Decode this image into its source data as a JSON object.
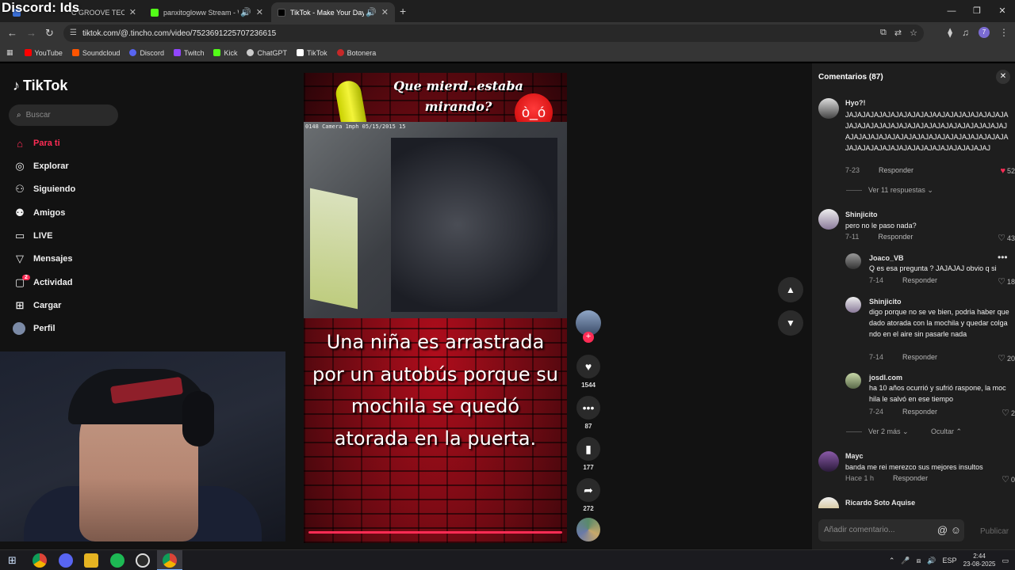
{
  "overlay": {
    "discord_label": "Discord: Ids"
  },
  "tabs": [
    {
      "label": "C GROOVE TECH",
      "active": false
    },
    {
      "label": "panxitogloww Stream - Wa",
      "active": false
    },
    {
      "label": "TikTok - Make Your Day",
      "active": true
    }
  ],
  "address_bar": {
    "url": "tiktok.com/@.tincho.com/video/7523691225707236615",
    "profile_initial": "7"
  },
  "bookmarks": [
    {
      "label": "YouTube",
      "color": "#ff0000"
    },
    {
      "label": "Soundcloud",
      "color": "#ff5500"
    },
    {
      "label": "Discord",
      "color": "#5865f2"
    },
    {
      "label": "Twitch",
      "color": "#9146ff"
    },
    {
      "label": "Kick",
      "color": "#53fc18"
    },
    {
      "label": "ChatGPT",
      "color": "#cccccc"
    },
    {
      "label": "TikTok",
      "color": "#ffffff"
    },
    {
      "label": "Botonera",
      "color": "#c62828"
    }
  ],
  "sidebar": {
    "logo": "TikTok",
    "search_placeholder": "Buscar",
    "items": [
      {
        "label": "Para ti",
        "icon": "home-icon",
        "active": true
      },
      {
        "label": "Explorar",
        "icon": "compass-icon"
      },
      {
        "label": "Siguiendo",
        "icon": "following-icon"
      },
      {
        "label": "Amigos",
        "icon": "friends-icon"
      },
      {
        "label": "LIVE",
        "icon": "live-icon"
      },
      {
        "label": "Mensajes",
        "icon": "messages-icon"
      },
      {
        "label": "Actividad",
        "icon": "activity-icon",
        "badge": "2"
      },
      {
        "label": "Cargar",
        "icon": "upload-icon"
      },
      {
        "label": "Perfil",
        "icon": "profile-icon"
      }
    ]
  },
  "video": {
    "top_caption": "Que mierd..estaba mirando?",
    "timestamp": "0148 Camera  1mph 05/15/2015 15",
    "caption": "Una niña es arrastrada por un autobús porque su mochila se quedó atorada en la puerta."
  },
  "actions": {
    "likes": "1544",
    "comments": "87",
    "saves": "177",
    "shares": "272"
  },
  "comments": {
    "header": "Comentarios (87)",
    "list": [
      {
        "user": "Hyo?!",
        "text": "JAJAJAJAJAJAJAJAJAJAJAAJAJAJAJAJAJAJAJAJAJAJAJAJAJAJAJAJAJAJAJAJAJAJAJAJAJAJAJAJAJAJAJAJAJAJAJAJAJAJAJAJAJAJAJAJAJAJAJAJAJAJAJAJAJAJAJAJAJAJAJAJAJAJAJAJ",
        "date": "7-23",
        "reply": "Responder",
        "likes": "52",
        "liked": true
      },
      {
        "user": "Shinjicito",
        "text": "pero no le paso nada?",
        "date": "7-11",
        "reply": "Responder",
        "likes": "43"
      },
      {
        "user": "Joaco_VB",
        "text": "Q es esa pregunta ? JAJAJAJ obvio q si",
        "date": "7-14",
        "reply": "Responder",
        "likes": "18"
      },
      {
        "user": "Shinjicito",
        "text": "digo porque no se ve bien, podria haber quedado atorada con la mochila y quedar colgando en el aire sin pasarle nada",
        "date": "7-14",
        "reply": "Responder",
        "likes": "20"
      },
      {
        "user": "josdl.com",
        "text": "ha 10 años ocurrió y sufrió raspone, la mochila le salvó en ese tiempo",
        "date": "7-24",
        "reply": "Responder",
        "likes": "2"
      },
      {
        "user": "Mayc",
        "text": "banda me rei merezco sus mejores insultos",
        "date": "Hace 1 h",
        "reply": "Responder",
        "likes": "0"
      },
      {
        "user": "Ricardo Soto Aquise"
      }
    ],
    "view_replies": "Ver 11 respuestas",
    "view_more": "Ver 2 más",
    "hide": "Ocultar",
    "input_placeholder": "Añadir comentario...",
    "publish": "Publicar"
  },
  "taskbar": {
    "lang": "ESP",
    "time": "2:44",
    "date": "23-08-2025"
  }
}
